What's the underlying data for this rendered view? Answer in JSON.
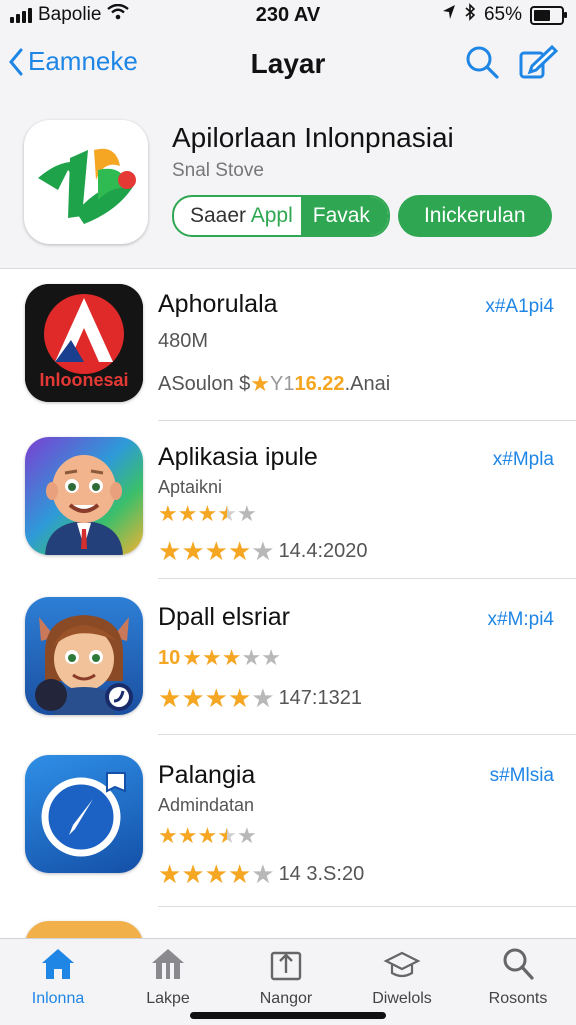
{
  "status": {
    "carrier": "Bapolie",
    "time": "230 AV",
    "battery": "65%",
    "battery_level": 0.65
  },
  "nav": {
    "back_label": "Eamneke",
    "title": "Layar"
  },
  "header": {
    "title": "Apilorlaan Inlonpnasiai",
    "subtitle": "Snal Stove",
    "btn_left_a": "Saaer ",
    "btn_left_b": "Appl",
    "btn_right": "Favak",
    "btn_main": "Inickerulan"
  },
  "apps": [
    {
      "name": "Aphorulala",
      "sub": "480M",
      "meta_prefix": "ASoulon $",
      "meta_mid": " Y1 ",
      "meta_score": "16.22",
      "meta_suffix": ".Anai",
      "price": "x#A1pi4",
      "icon_text": "Inloonesai"
    },
    {
      "name": "Aplikasia ipule",
      "sub": "Aptaikni",
      "rating_a": 3.5,
      "rating_b": 4,
      "rating_b_text": "14.4:2020",
      "price": "x#Mpla"
    },
    {
      "name": "Dpall elsriar",
      "sub_prefix": "10",
      "rating_a": 3,
      "rating_b": 4,
      "rating_b_text": "147:1321",
      "price": "x#M:pi4"
    },
    {
      "name": "Palangia",
      "sub": "Admindatan",
      "rating_a": 3.5,
      "rating_b": 4,
      "rating_b_text": "14 3.S:20",
      "price": "s#Mlsia"
    }
  ],
  "tabs": [
    {
      "label": "Inlonna",
      "icon": "home-icon",
      "active": true
    },
    {
      "label": "Lakpe",
      "icon": "store-icon"
    },
    {
      "label": "Nangor",
      "icon": "update-icon"
    },
    {
      "label": "Diwelols",
      "icon": "download-icon"
    },
    {
      "label": "Rosonts",
      "icon": "search-icon"
    }
  ],
  "colors": {
    "accent": "#1f86e6",
    "green": "#2fa752",
    "star": "#f5a623"
  }
}
